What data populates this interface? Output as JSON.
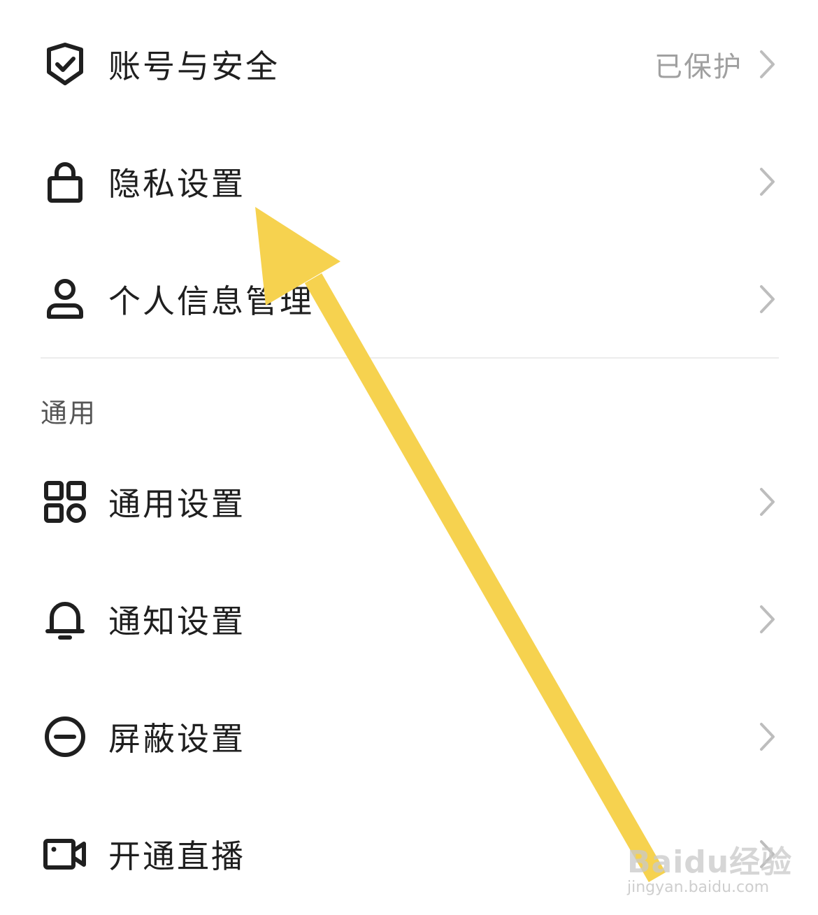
{
  "account_section": {
    "items": [
      {
        "label": "账号与安全",
        "value": "已保护",
        "icon": "shield-check-icon"
      },
      {
        "label": "隐私设置",
        "icon": "lock-icon"
      },
      {
        "label": "个人信息管理",
        "icon": "person-icon"
      }
    ]
  },
  "general_section": {
    "header": "通用",
    "items": [
      {
        "label": "通用设置",
        "icon": "grid-apps-icon"
      },
      {
        "label": "通知设置",
        "icon": "bell-icon"
      },
      {
        "label": "屏蔽设置",
        "icon": "block-minus-icon"
      },
      {
        "label": "开通直播",
        "icon": "video-camera-icon"
      }
    ]
  },
  "annotation": {
    "arrow_color": "#F6D24F"
  },
  "watermark": {
    "brand": "Baidu经验",
    "url": "jingyan.baidu.com"
  },
  "colors": {
    "text": "#1f1f1f",
    "secondary": "#a0a0a0",
    "chevron": "#bdbdbd",
    "divider": "#ececec"
  }
}
